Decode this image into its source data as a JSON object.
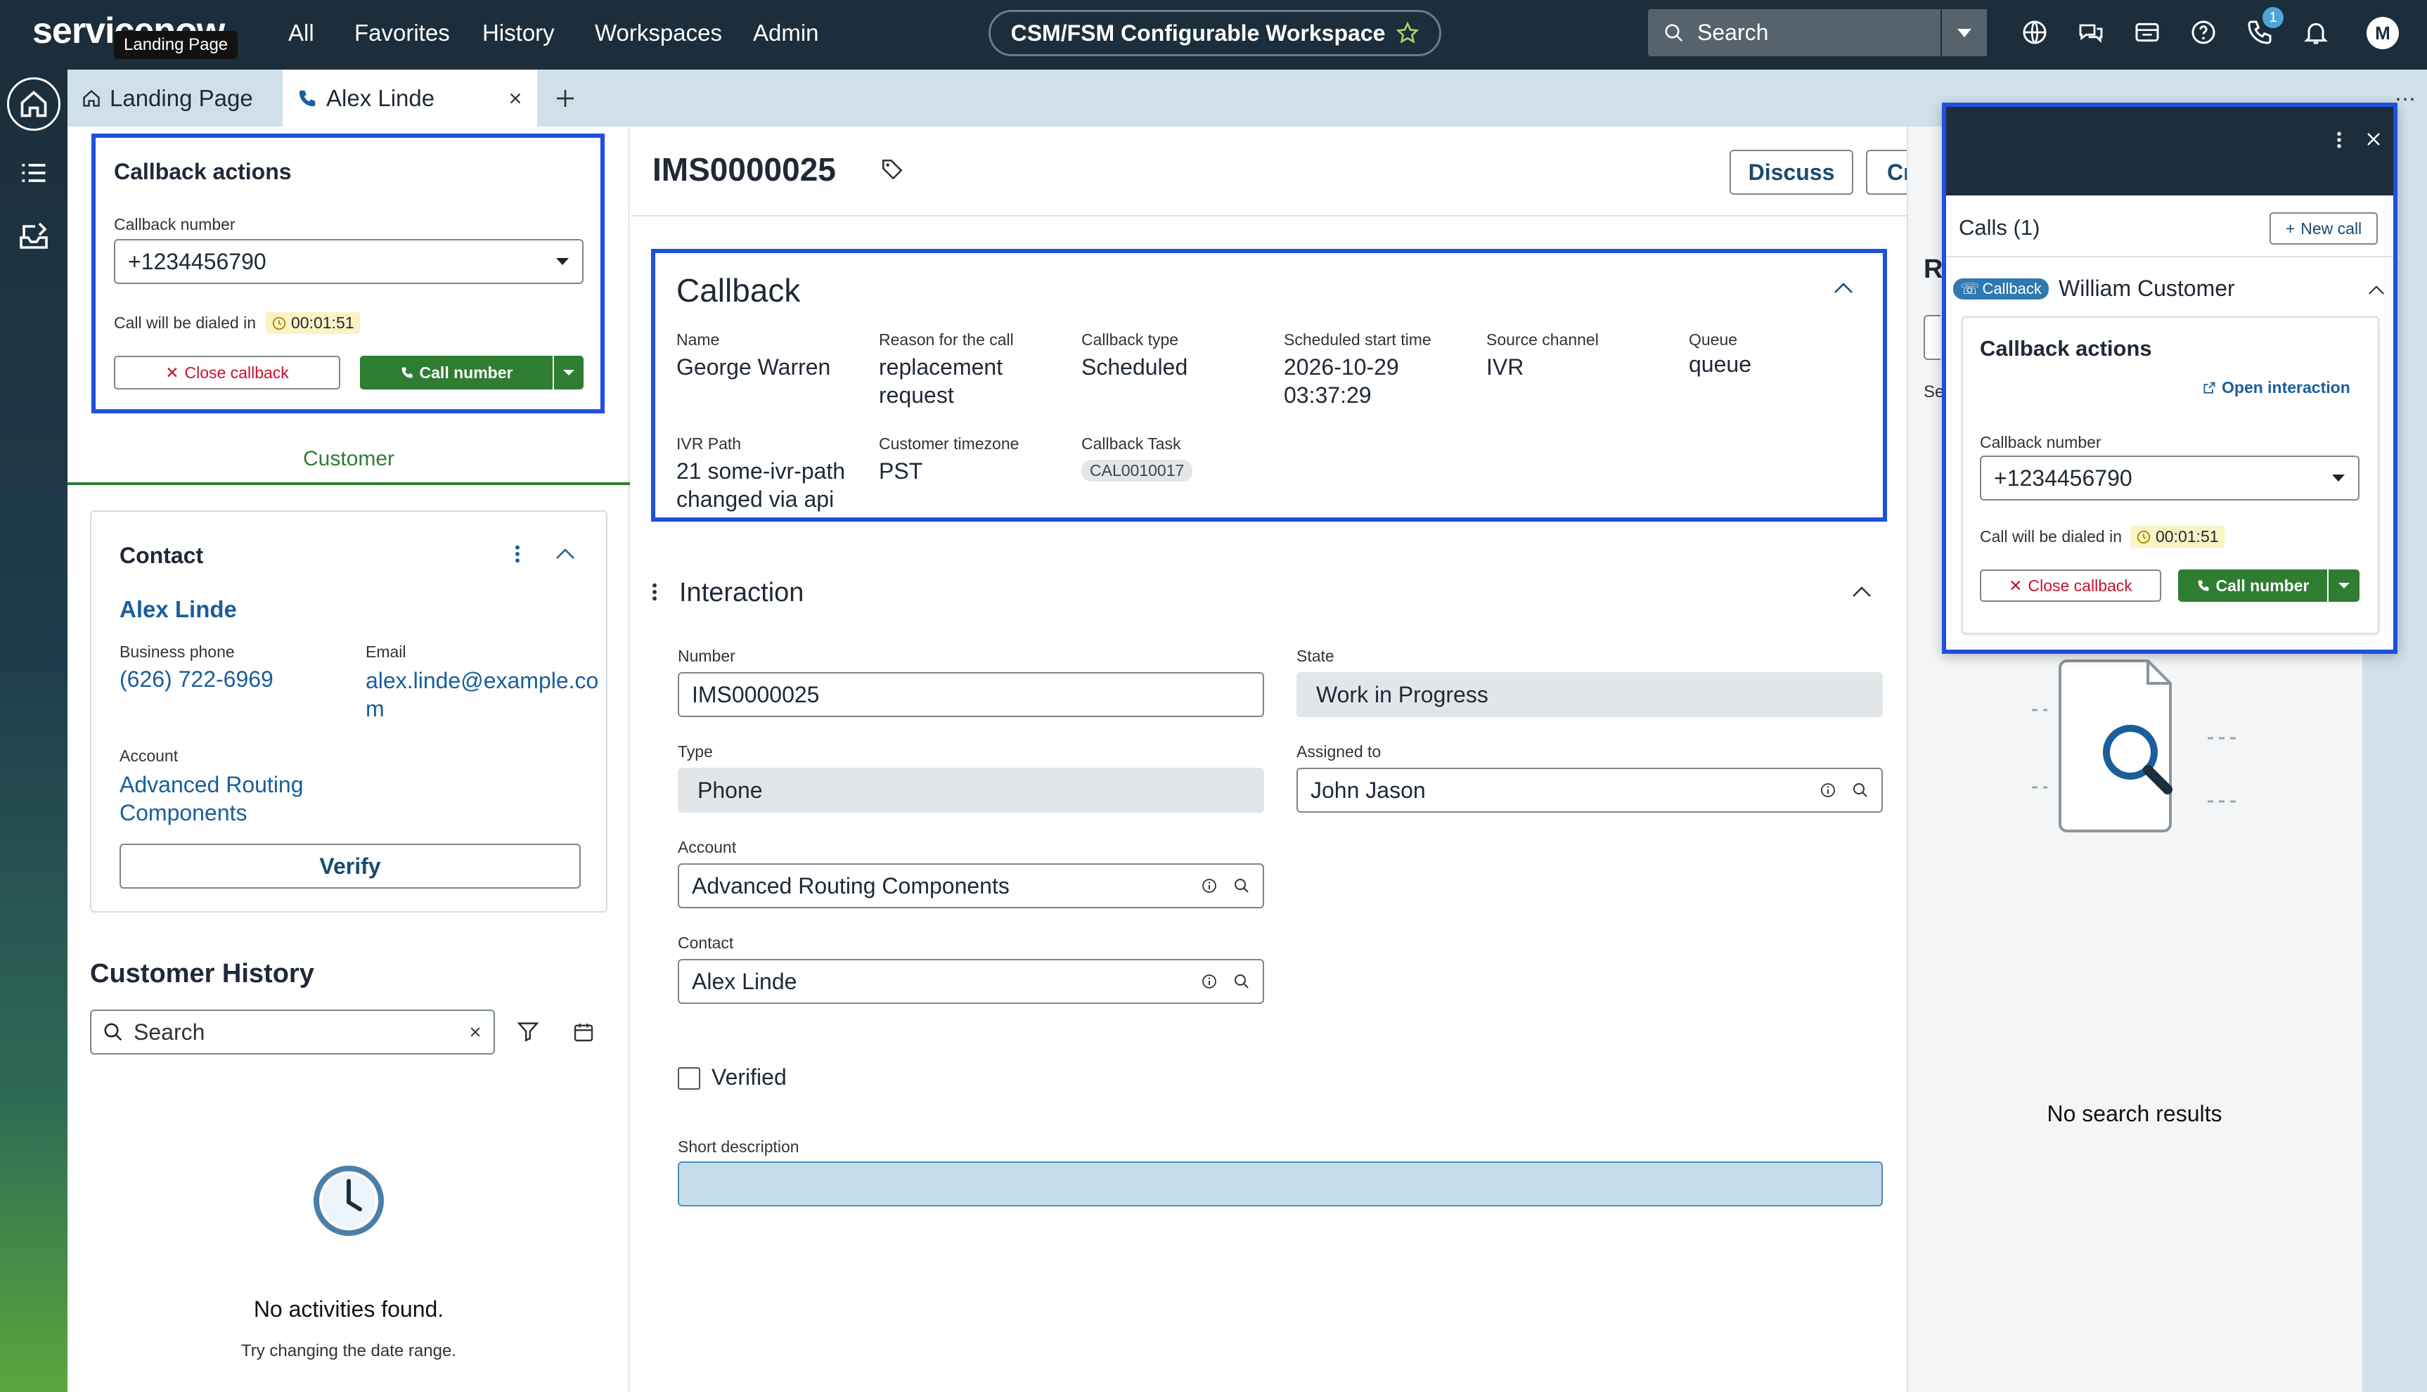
{
  "nav": {
    "logo": "servicenow",
    "tooltip": "Landing Page",
    "links": [
      "All",
      "Favorites",
      "History",
      "Workspaces",
      "Admin"
    ],
    "workspace": "CSM/FSM Configurable Workspace",
    "search_placeholder": "Search",
    "phone_badge": "1",
    "avatar": "M"
  },
  "tabs": [
    {
      "label": "Landing Page",
      "icon": "home-icon"
    },
    {
      "label": "Alex Linde",
      "icon": "phone-icon"
    }
  ],
  "left_callback": {
    "title": "Callback actions",
    "number_label": "Callback number",
    "number": "+1234456790",
    "dial_label": "Call will be dialed in",
    "timer": "00:01:51",
    "close_label": "Close callback",
    "call_label": "Call number"
  },
  "customer_tab": "Customer",
  "contact": {
    "title": "Contact",
    "name": "Alex Linde",
    "phone_label": "Business phone",
    "phone": "(626) 722-6969",
    "email_label": "Email",
    "email_line1": "alex.linde@example.co",
    "email_line2": "m",
    "account_label": "Account",
    "account_line1": "Advanced Routing",
    "account_line2": "Components",
    "verify_label": "Verify"
  },
  "history": {
    "title": "Customer History",
    "search_placeholder": "Search",
    "empty_title": "No activities found.",
    "empty_sub": "Try changing the date range."
  },
  "record": {
    "number": "IMS0000025",
    "discuss": "Discuss",
    "create": "Creat"
  },
  "callback_section": {
    "title": "Callback",
    "fields": [
      {
        "label": "Name",
        "value_lines": [
          "George Warren"
        ]
      },
      {
        "label": "Reason for the call",
        "value_lines": [
          "replacement",
          "request"
        ]
      },
      {
        "label": "Callback type",
        "value_lines": [
          "Scheduled"
        ]
      },
      {
        "label": "Scheduled start time",
        "value_lines": [
          "2026-10-29",
          "03:37:29"
        ]
      },
      {
        "label": "Source channel",
        "value_lines": [
          "IVR"
        ]
      },
      {
        "label": "Queue",
        "value_lines": [
          "queue"
        ]
      },
      {
        "label": "IVR Path",
        "value_lines": [
          "21 some-ivr-path",
          "changed via api"
        ]
      },
      {
        "label": "Customer timezone",
        "value_lines": [
          "PST"
        ]
      },
      {
        "label": "Callback Task",
        "value_lines": [
          "CAL0010017"
        ]
      }
    ]
  },
  "interaction": {
    "title": "Interaction",
    "number_label": "Number",
    "number": "IMS0000025",
    "state_label": "State",
    "state": "Work in Progress",
    "type_label": "Type",
    "type": "Phone",
    "assigned_label": "Assigned to",
    "assigned": "John Jason",
    "account_label": "Account",
    "account": "Advanced Routing Components",
    "contact_label": "Contact",
    "contact": "Alex Linde",
    "verified_label": "Verified",
    "short_desc_label": "Short description",
    "short_desc": ""
  },
  "right_panel": {
    "peek_title": "R",
    "peek_se": "Se",
    "no_results": "No search results"
  },
  "calls_panel": {
    "title": "Calls (1)",
    "new_call": "New call",
    "callback_badge": "Callback",
    "customer": "William Customer",
    "actions_title": "Callback actions",
    "open_interaction": "Open interaction",
    "number_label": "Callback number",
    "number": "+1234456790",
    "dial_label": "Call will be dialed in",
    "timer": "00:01:51",
    "close_label": "Close callback",
    "call_label": "Call number"
  },
  "colors": {
    "nav_bg": "#1c2e3b",
    "highlight": "#1f4fe0",
    "green": "#2e7d32",
    "link": "#1a5e9c",
    "tabbar": "#cfe0e8"
  }
}
